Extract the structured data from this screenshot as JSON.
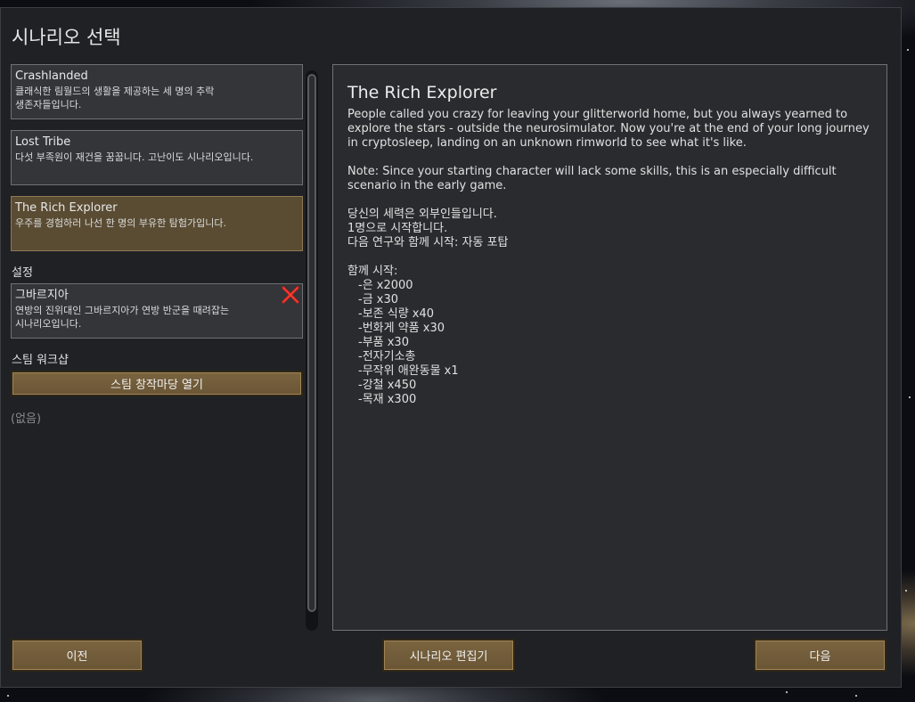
{
  "title": "시나리오 선택",
  "scenarios": [
    {
      "name": "Crashlanded",
      "desc": [
        "클래식한 림월드의 생활을 제공하는 세 명의 추락",
        "생존자들입니다."
      ]
    },
    {
      "name": "Lost Tribe",
      "desc": [
        "다섯 부족원이 재건을 꿈꿉니다. 고난이도 시나리오입니다."
      ]
    },
    {
      "name": "The Rich Explorer",
      "desc": [
        "우주를 경험하러 나선 한 명의 부유한 탐험가입니다."
      ]
    }
  ],
  "settings": {
    "label": "설정",
    "storyteller": {
      "name": "그바르지아",
      "desc": [
        "연방의 진위대인 그바르지아가 연방 반군을 때려잡는",
        "시나리오입니다."
      ]
    }
  },
  "workshop": {
    "label": "스팀 워크샵",
    "open_button": "스팀 창작마당 열기",
    "none_label": "(없음)"
  },
  "detail": {
    "title": "The Rich Explorer",
    "desc_lines": [
      "People called you crazy for leaving your glitterworld home, but you always yearned to",
      "explore the stars - outside the neurosimulator. Now you're at the end of your long journey",
      "in cryptosleep, landing on an unknown rimworld to see what it's like."
    ],
    "note_lines": [
      "Note: Since your starting character will lack some skills, this is an especially difficult",
      "scenario in the early game."
    ],
    "faction_lines": [
      "당신의 세력은 외부인들입니다.",
      "1명으로 시작합니다.",
      "다음 연구와 함께 시작: 자동 포탑"
    ],
    "start_with_label": "함께 시작:",
    "start_items": [
      "-은 x2000",
      "-금 x30",
      "-보존 식량 x40",
      "-번화게 약품 x30",
      "-부품 x30",
      "-전자기소총",
      "-무작위 애완동물 x1",
      "-강철 x450",
      "-목재 x300"
    ]
  },
  "buttons": {
    "prev": "이전",
    "editor": "시나리오 편집기",
    "next": "다음"
  },
  "colors": {
    "selected_bg": "#5a4c33",
    "button_bg": "#6f5a38",
    "remove_icon": "#d0201c"
  }
}
